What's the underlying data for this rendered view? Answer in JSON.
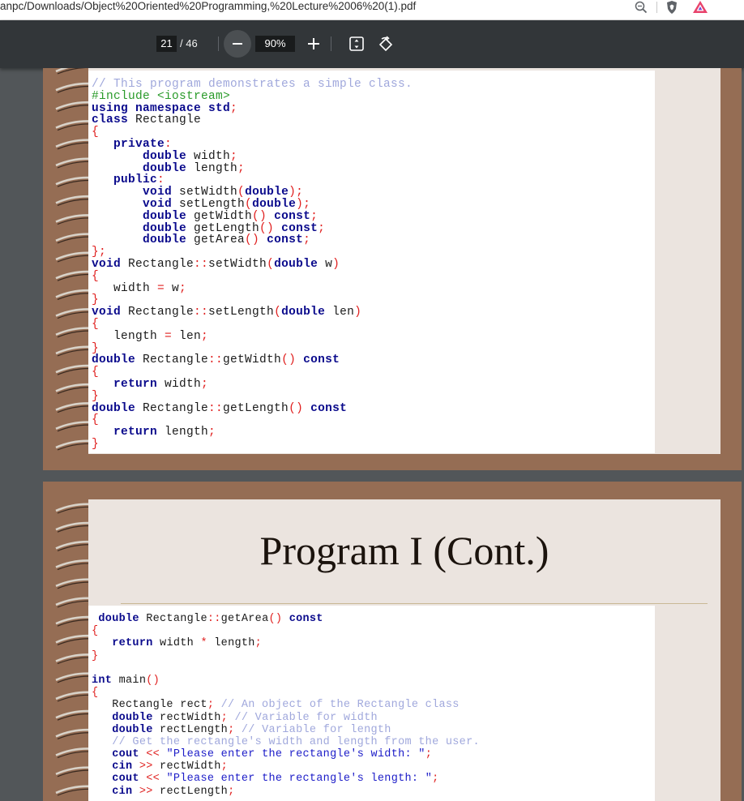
{
  "browser": {
    "url": "anpc/Downloads/Object%20Oriented%20Programming,%20Lecture%2006%20(1).pdf",
    "icons": [
      "zoom-icon",
      "brave-shield-icon",
      "brave-rewards-icon"
    ]
  },
  "toolbar": {
    "page_current": "21",
    "page_total": "/ 46",
    "zoom": "90%",
    "icons": [
      "zoom-out-icon",
      "zoom-in-icon",
      "fit-page-icon",
      "rotate-icon"
    ]
  },
  "slide1": {
    "code_lines": [
      [
        [
          "cm",
          "// This program demonstrates a simple class."
        ]
      ],
      [
        [
          "pp",
          "#include <iostream>"
        ]
      ],
      [
        [
          "kw",
          "using namespace std"
        ],
        [
          "pu",
          ";"
        ]
      ],
      [
        [
          "kw",
          "class"
        ],
        [
          "tx",
          " Rectangle"
        ]
      ],
      [
        [
          "pu",
          "{"
        ]
      ],
      [
        [
          "tx",
          "   "
        ],
        [
          "kw",
          "private"
        ],
        [
          "pu",
          ":"
        ]
      ],
      [
        [
          "tx",
          "       "
        ],
        [
          "kw",
          "double"
        ],
        [
          "tx",
          " width"
        ],
        [
          "pu",
          ";"
        ]
      ],
      [
        [
          "tx",
          "       "
        ],
        [
          "kw",
          "double"
        ],
        [
          "tx",
          " length"
        ],
        [
          "pu",
          ";"
        ]
      ],
      [
        [
          "tx",
          "   "
        ],
        [
          "kw",
          "public"
        ],
        [
          "pu",
          ":"
        ]
      ],
      [
        [
          "tx",
          "       "
        ],
        [
          "kw",
          "void"
        ],
        [
          "tx",
          " setWidth"
        ],
        [
          "pu",
          "("
        ],
        [
          "kw",
          "double"
        ],
        [
          "pu",
          ");"
        ]
      ],
      [
        [
          "tx",
          "       "
        ],
        [
          "kw",
          "void"
        ],
        [
          "tx",
          " setLength"
        ],
        [
          "pu",
          "("
        ],
        [
          "kw",
          "double"
        ],
        [
          "pu",
          ");"
        ]
      ],
      [
        [
          "tx",
          "       "
        ],
        [
          "kw",
          "double"
        ],
        [
          "tx",
          " getWidth"
        ],
        [
          "pu",
          "()"
        ],
        [
          "tx",
          " "
        ],
        [
          "kw",
          "const"
        ],
        [
          "pu",
          ";"
        ]
      ],
      [
        [
          "tx",
          "       "
        ],
        [
          "kw",
          "double"
        ],
        [
          "tx",
          " getLength"
        ],
        [
          "pu",
          "()"
        ],
        [
          "tx",
          " "
        ],
        [
          "kw",
          "const"
        ],
        [
          "pu",
          ";"
        ]
      ],
      [
        [
          "tx",
          "       "
        ],
        [
          "kw",
          "double"
        ],
        [
          "tx",
          " getArea"
        ],
        [
          "pu",
          "()"
        ],
        [
          "tx",
          " "
        ],
        [
          "kw",
          "const"
        ],
        [
          "pu",
          ";"
        ]
      ],
      [
        [
          "pu",
          "};"
        ]
      ],
      [
        [
          "kw",
          "void"
        ],
        [
          "tx",
          " Rectangle"
        ],
        [
          "pu",
          "::"
        ],
        [
          "tx",
          "setWidth"
        ],
        [
          "pu",
          "("
        ],
        [
          "kw",
          "double"
        ],
        [
          "tx",
          " w"
        ],
        [
          "pu",
          ")"
        ]
      ],
      [
        [
          "pu",
          "{"
        ]
      ],
      [
        [
          "tx",
          "   width "
        ],
        [
          "pu",
          "="
        ],
        [
          "tx",
          " w"
        ],
        [
          "pu",
          ";"
        ]
      ],
      [
        [
          "pu",
          "}"
        ]
      ],
      [
        [
          "kw",
          "void"
        ],
        [
          "tx",
          " Rectangle"
        ],
        [
          "pu",
          "::"
        ],
        [
          "tx",
          "setLength"
        ],
        [
          "pu",
          "("
        ],
        [
          "kw",
          "double"
        ],
        [
          "tx",
          " len"
        ],
        [
          "pu",
          ")"
        ]
      ],
      [
        [
          "pu",
          "{"
        ]
      ],
      [
        [
          "tx",
          "   length "
        ],
        [
          "pu",
          "="
        ],
        [
          "tx",
          " len"
        ],
        [
          "pu",
          ";"
        ]
      ],
      [
        [
          "pu",
          "}"
        ]
      ],
      [
        [
          "kw",
          "double"
        ],
        [
          "tx",
          " Rectangle"
        ],
        [
          "pu",
          "::"
        ],
        [
          "tx",
          "getWidth"
        ],
        [
          "pu",
          "()"
        ],
        [
          "tx",
          " "
        ],
        [
          "kw",
          "const"
        ]
      ],
      [
        [
          "pu",
          "{"
        ]
      ],
      [
        [
          "tx",
          "   "
        ],
        [
          "kw",
          "return"
        ],
        [
          "tx",
          " width"
        ],
        [
          "pu",
          ";"
        ]
      ],
      [
        [
          "pu",
          "}"
        ]
      ],
      [
        [
          "kw",
          "double"
        ],
        [
          "tx",
          " Rectangle"
        ],
        [
          "pu",
          "::"
        ],
        [
          "tx",
          "getLength"
        ],
        [
          "pu",
          "()"
        ],
        [
          "tx",
          " "
        ],
        [
          "kw",
          "const"
        ]
      ],
      [
        [
          "pu",
          "{"
        ]
      ],
      [
        [
          "tx",
          "   "
        ],
        [
          "kw",
          "return"
        ],
        [
          "tx",
          " length"
        ],
        [
          "pu",
          ";"
        ]
      ],
      [
        [
          "pu",
          "}"
        ]
      ]
    ]
  },
  "slide2": {
    "title": "Program I (Cont.)",
    "code_lines": [
      [
        [
          "tx",
          " "
        ],
        [
          "kw",
          "double"
        ],
        [
          "tx",
          " Rectangle"
        ],
        [
          "pu",
          "::"
        ],
        [
          "tx",
          "getArea"
        ],
        [
          "pu",
          "()"
        ],
        [
          "tx",
          " "
        ],
        [
          "kw",
          "const"
        ]
      ],
      [
        [
          "pu",
          "{"
        ]
      ],
      [
        [
          "tx",
          "   "
        ],
        [
          "kw",
          "return"
        ],
        [
          "tx",
          " width "
        ],
        [
          "pu",
          "*"
        ],
        [
          "tx",
          " length"
        ],
        [
          "pu",
          ";"
        ]
      ],
      [
        [
          "pu",
          "}"
        ]
      ],
      [
        [
          "tx",
          ""
        ]
      ],
      [
        [
          "kw",
          "int"
        ],
        [
          "tx",
          " main"
        ],
        [
          "pu",
          "()"
        ]
      ],
      [
        [
          "pu",
          "{"
        ]
      ],
      [
        [
          "tx",
          "   Rectangle rect"
        ],
        [
          "pu",
          ";"
        ],
        [
          "tx",
          " "
        ],
        [
          "cm",
          "// An object of the Rectangle class"
        ]
      ],
      [
        [
          "tx",
          "   "
        ],
        [
          "kw",
          "double"
        ],
        [
          "tx",
          " rectWidth"
        ],
        [
          "pu",
          ";"
        ],
        [
          "tx",
          " "
        ],
        [
          "cm",
          "// Variable for width"
        ]
      ],
      [
        [
          "tx",
          "   "
        ],
        [
          "kw",
          "double"
        ],
        [
          "tx",
          " rectLength"
        ],
        [
          "pu",
          ";"
        ],
        [
          "tx",
          " "
        ],
        [
          "cm",
          "// Variable for length"
        ]
      ],
      [
        [
          "tx",
          "   "
        ],
        [
          "cm",
          "// Get the rectangle's width and length from the user."
        ]
      ],
      [
        [
          "tx",
          "   "
        ],
        [
          "kw",
          "cout"
        ],
        [
          "tx",
          " "
        ],
        [
          "pu",
          "<<"
        ],
        [
          "tx",
          " "
        ],
        [
          "st",
          "\"Please enter the rectangle's width: \""
        ],
        [
          "pu",
          ";"
        ]
      ],
      [
        [
          "tx",
          "   "
        ],
        [
          "kw",
          "cin"
        ],
        [
          "tx",
          " "
        ],
        [
          "pu",
          ">>"
        ],
        [
          "tx",
          " rectWidth"
        ],
        [
          "pu",
          ";"
        ]
      ],
      [
        [
          "tx",
          "   "
        ],
        [
          "kw",
          "cout"
        ],
        [
          "tx",
          " "
        ],
        [
          "pu",
          "<<"
        ],
        [
          "tx",
          " "
        ],
        [
          "st",
          "\"Please enter the rectangle's length: \""
        ],
        [
          "pu",
          ";"
        ]
      ],
      [
        [
          "tx",
          "   "
        ],
        [
          "kw",
          "cin"
        ],
        [
          "tx",
          " "
        ],
        [
          "pu",
          ">>"
        ],
        [
          "tx",
          " rectLength"
        ],
        [
          "pu",
          ";"
        ]
      ]
    ]
  },
  "colors": {
    "toolbar_bg": "#323639",
    "viewer_bg": "#525659",
    "slide_frame": "#956d54",
    "slide_paper": "#ebe4df",
    "keyword": "#0a0a8c",
    "comment": "#a0a8dc",
    "preprocessor": "#2a9b2a",
    "punctuation": "#e0201f",
    "string": "#1c1cc8"
  }
}
